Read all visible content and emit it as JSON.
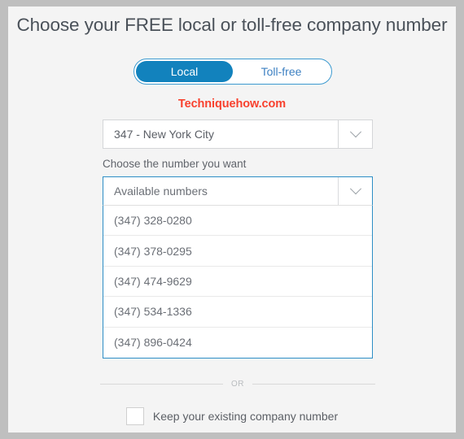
{
  "page": {
    "title": "Choose your FREE local or toll-free company number",
    "watermark": "Techniquehow.com",
    "background_color": "#f4f4f4",
    "frame_color": "#bfbfbf"
  },
  "toggle": {
    "options": [
      {
        "label": "Local",
        "selected": true
      },
      {
        "label": "Toll-free",
        "selected": false
      }
    ],
    "active_color": "#1282bd",
    "border_color": "#3c9ad0",
    "inactive_text_color": "#3d80c2"
  },
  "city_select": {
    "value": "347 - New York City",
    "arrow_icon": "chevron-down-icon",
    "border_color": "#d4d6d8"
  },
  "number_section": {
    "label": "Choose the number you want",
    "select_value": "Available numbers",
    "arrow_icon": "chevron-down-icon",
    "border_color": "#2d8ec6",
    "options": [
      "(347) 328-0280",
      "(347) 378-0295",
      "(347) 474-9629",
      "(347) 534-1336",
      "(347) 896-0424"
    ]
  },
  "divider": {
    "text": "OR",
    "line_color": "#d8d8d8"
  },
  "keep_number": {
    "label": "Keep your existing company number",
    "checked": false
  }
}
